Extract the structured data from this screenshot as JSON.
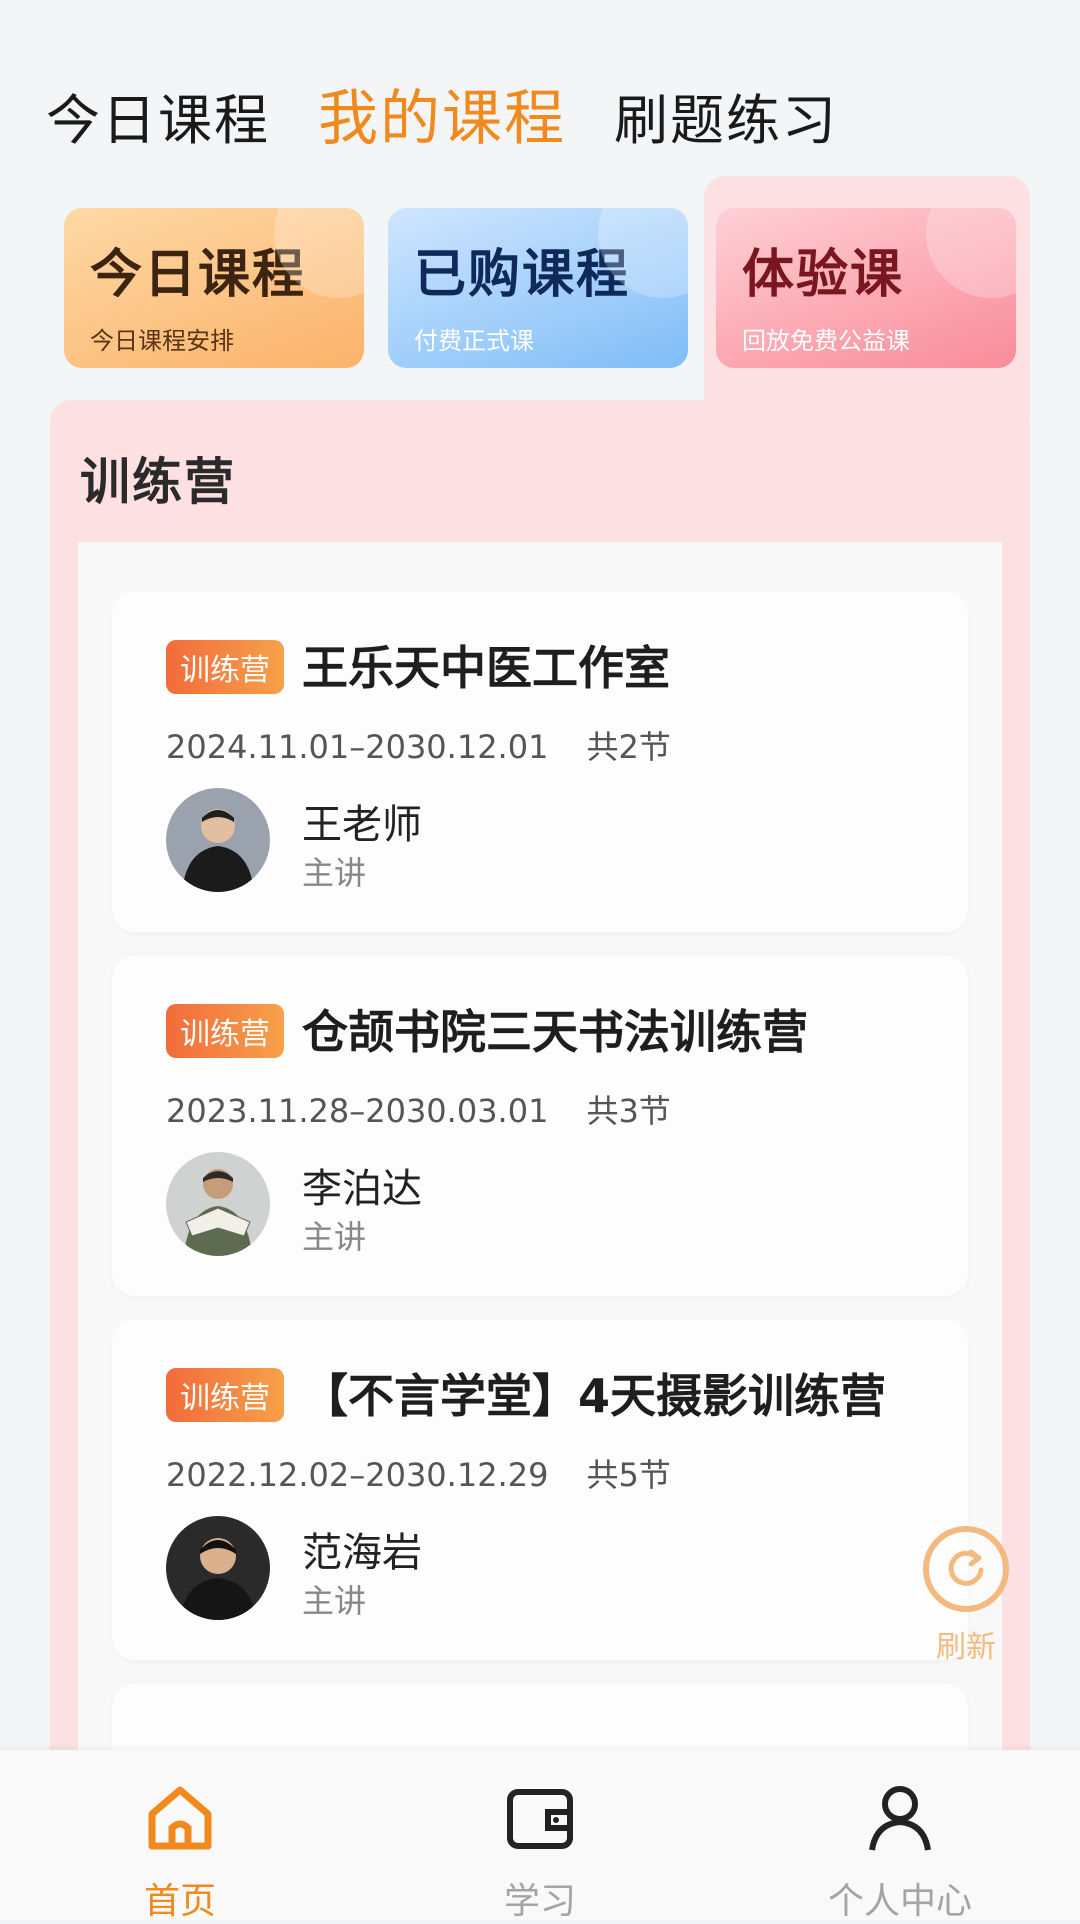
{
  "top_tabs": [
    {
      "label": "今日课程",
      "active": false
    },
    {
      "label": "我的课程",
      "active": true
    },
    {
      "label": "刷题练习",
      "active": false
    }
  ],
  "category_cards": [
    {
      "title": "今日课程",
      "subtitle": "今日课程安排"
    },
    {
      "title": "已购课程",
      "subtitle": "付费正式课"
    },
    {
      "title": "体验课",
      "subtitle": "回放免费公益课"
    }
  ],
  "section_title": "训练营",
  "courses": [
    {
      "badge": "训练营",
      "title": "王乐天中医工作室",
      "dates": "2024.11.01–2030.12.01",
      "count": "共2节",
      "teacher": "王老师",
      "role": "主讲"
    },
    {
      "badge": "训练营",
      "title": "仓颉书院三天书法训练营",
      "dates": "2023.11.28–2030.03.01",
      "count": "共3节",
      "teacher": "李泊达",
      "role": "主讲"
    },
    {
      "badge": "训练营",
      "title": "【不言学堂】4天摄影训练营",
      "dates": "2022.12.02–2030.12.29",
      "count": "共5节",
      "teacher": "范海岩",
      "role": "主讲"
    }
  ],
  "refresh_label": "刷新",
  "bottom_nav": [
    {
      "label": "首页",
      "icon": "home-icon",
      "active": true
    },
    {
      "label": "学习",
      "icon": "wallet-icon",
      "active": false
    },
    {
      "label": "个人中心",
      "icon": "user-icon",
      "active": false
    }
  ],
  "colors": {
    "accent": "#f08a1c",
    "panel": "#fde0e2",
    "badge": "#f26b3a"
  }
}
